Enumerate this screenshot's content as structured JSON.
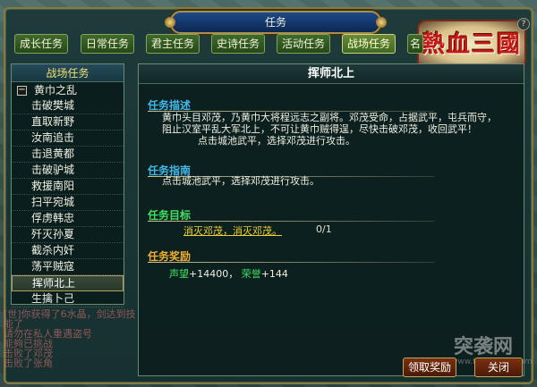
{
  "window": {
    "title": "任务"
  },
  "logo": {
    "text": "熱血三國"
  },
  "help": {
    "label": "?"
  },
  "tabs": [
    {
      "label": "成长任务",
      "active": false
    },
    {
      "label": "日常任务",
      "active": false
    },
    {
      "label": "君主任务",
      "active": false
    },
    {
      "label": "史诗任务",
      "active": false
    },
    {
      "label": "活动任务",
      "active": false
    },
    {
      "label": "战场任务",
      "active": true
    },
    {
      "label": "名",
      "active": false
    }
  ],
  "sidebar": {
    "header": "战场任务",
    "group": {
      "expand_symbol": "−",
      "label": "黄巾之乱"
    },
    "items": [
      {
        "label": "击破樊城"
      },
      {
        "label": "直取新野"
      },
      {
        "label": "汝南追击"
      },
      {
        "label": "击退黄都"
      },
      {
        "label": "击破驴城"
      },
      {
        "label": "救援南阳"
      },
      {
        "label": "扫平宛城"
      },
      {
        "label": "俘虏韩忠"
      },
      {
        "label": "歼灭孙夏"
      },
      {
        "label": "截杀内奸"
      },
      {
        "label": "荡平贼寇"
      },
      {
        "label": "挥师北上",
        "selected": true
      },
      {
        "label": "生擒卜己"
      }
    ]
  },
  "main": {
    "title": "挥师北上",
    "description": {
      "heading": "任务描述",
      "line1": "黄巾头目邓茂，乃黄巾大将程远志之副将。邓茂受命，占据武平，屯兵而守，",
      "line2": "阻止汉室平乱大军北上，不可让黄巾贼得逞，尽快击破邓茂，收回武平！",
      "line3": "点击城池武平，选择邓茂进行攻击。"
    },
    "guide": {
      "heading": "任务指南",
      "text": "点击城池武平，选择邓茂进行攻击。"
    },
    "goal": {
      "heading": "任务目标",
      "link": "消灭邓茂，消灭邓茂。",
      "progress": "0/1"
    },
    "reward": {
      "heading": "任务奖励",
      "items": [
        {
          "name": "声望",
          "value": "+14400，"
        },
        {
          "name": "荣誉",
          "value": "+144"
        }
      ]
    }
  },
  "buttons": {
    "claim": "领取奖励",
    "close": "关闭"
  },
  "chat": {
    "lines": [
      "[世]你获得了6水晶，剑达到技能了",
      "请勿在私人重遇盗号",
      "能夠已挑战",
      "击败了邓茂",
      "击败了张角"
    ]
  },
  "watermark": {
    "text": "突袭网",
    "sub": "www.tuxiangzu.com"
  },
  "colors": {
    "heading_description": "#40b8e8",
    "heading_guide": "#40b8e8",
    "heading_goal": "#40e060",
    "heading_reward": "#f0b030"
  }
}
